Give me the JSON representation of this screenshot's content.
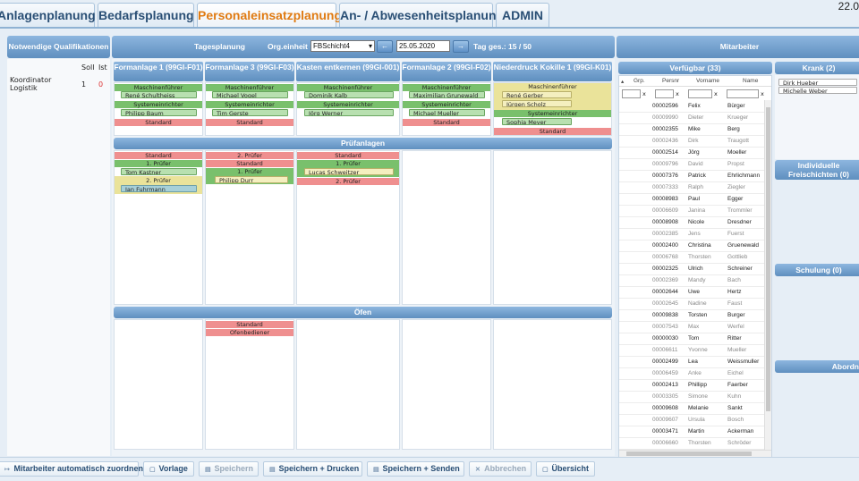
{
  "tabs": [
    "Anlagenplanung",
    "Bedarfsplanung",
    "Personaleinsatzplanung",
    "An- / Abwesenheitsplanung",
    "ADMIN"
  ],
  "corner_text": "22.0",
  "left": {
    "title": "Notwendige Qualifikationen",
    "soll": "Soll",
    "ist": "Ist",
    "role": "Koordinator Logistik",
    "soll_val": "1",
    "ist_val": "0"
  },
  "tagesplanung": {
    "title": "Tagesplanung",
    "org_label": "Org.einheit",
    "org_value": "FBSchicht4",
    "date": "25.05.2020",
    "prev": "←",
    "next": "→",
    "summary": "Tag ges.: 15 / 50"
  },
  "columns": [
    {
      "title": "Formanlage 1 (99GI-F01)",
      "items": [
        {
          "bar": "Maschinenführer",
          "color": "g",
          "chips": [
            "René Schultheiss"
          ]
        },
        {
          "bar": "Systemeinrichter",
          "color": "g",
          "chips": [
            "Philipp Baum"
          ]
        },
        {
          "bar": "Standard",
          "color": "r",
          "chips": []
        }
      ]
    },
    {
      "title": "Formanlage 3 (99GI-F03)",
      "items": [
        {
          "bar": "Maschinenführer",
          "color": "g",
          "chips": [
            "Michael Vogel"
          ]
        },
        {
          "bar": "Systemeinrichter",
          "color": "g",
          "chips": [
            "Tim Gerste"
          ]
        },
        {
          "bar": "Standard",
          "color": "r",
          "chips": []
        }
      ]
    },
    {
      "title": "Kasten entkernen (99GI-001)",
      "items": [
        {
          "bar": "Maschinenführer",
          "color": "g",
          "chips": [
            "Dominik Kalb"
          ]
        },
        {
          "bar": "Systemeinrichter",
          "color": "g",
          "chips": [
            "Jörg Werner"
          ]
        }
      ]
    },
    {
      "title": "Formanlage 2 (99GI-F02)",
      "items": [
        {
          "bar": "Maschinenführer",
          "color": "g",
          "chips": [
            "Maximilian Grunewald"
          ]
        },
        {
          "bar": "Systemeinrichter",
          "color": "g",
          "chips": [
            "Michael Mueller"
          ]
        },
        {
          "bar": "Standard",
          "color": "r",
          "chips": []
        }
      ]
    },
    {
      "title": "Niederdruck Kokille 1 (99GI-K01)",
      "items": [
        {
          "bar": "Maschinenführer",
          "color": "y",
          "chips": [
            "René Gerber",
            "Jürgen Scholz"
          ]
        },
        {
          "bar": "Systemeinrichter",
          "color": "g",
          "chips": [
            "Sophia Meyer"
          ]
        },
        {
          "bar": "Standard",
          "color": "r",
          "chips": []
        }
      ]
    }
  ],
  "pruefanlagen": {
    "title": "Prüfanlagen",
    "cols": [
      [
        {
          "bar": "Standard",
          "color": "r",
          "chips": []
        },
        {
          "bar": "1. Prüfer",
          "color": "g",
          "chips": [
            "Tom Kastner"
          ]
        },
        {
          "bar": "2. Prüfer",
          "color": "y",
          "chips": [
            "Jan Fuhrmann"
          ]
        }
      ],
      [
        {
          "bar": "2. Prüfer",
          "color": "r",
          "chips": []
        },
        {
          "bar": "Standard",
          "color": "r",
          "chips": []
        },
        {
          "bar": "1. Prüfer",
          "color": "g",
          "chips": [
            "Philipp Durr"
          ]
        }
      ],
      [
        {
          "bar": "Standard",
          "color": "r",
          "chips": []
        },
        {
          "bar": "1. Prüfer",
          "color": "g",
          "chips": [
            "Lucas Schweitzer"
          ]
        },
        {
          "bar": "2. Prüfer",
          "color": "r",
          "chips": []
        }
      ]
    ]
  },
  "oefen": {
    "title": "Öfen",
    "cols": [
      [],
      [
        {
          "bar": "Standard",
          "color": "r",
          "chips": []
        },
        {
          "bar": "Ofenbediener",
          "color": "r",
          "chips": []
        }
      ]
    ]
  },
  "mitarbeiter": {
    "title": "Mitarbeiter",
    "verfuegbar": "Verfügbar (33)",
    "krank": "Krank (2)",
    "indiv": "Individuelle Freischichten (0)",
    "schulung": "Schulung (0)",
    "abord": "Abordn",
    "krank_list": [
      "Dirk Hueber",
      "Michelle Weber"
    ],
    "headers": [
      "Grp.",
      "Persnr",
      "Vorname",
      "Name"
    ],
    "rows": [
      [
        "00002596",
        "Felix",
        "Bürger",
        0
      ],
      [
        "00009990",
        "Dieter",
        "Krueger",
        1
      ],
      [
        "00002355",
        "Mike",
        "Berg",
        0
      ],
      [
        "00002436",
        "Dirk",
        "Traugott",
        1
      ],
      [
        "00002514",
        "Jörg",
        "Moeller",
        0
      ],
      [
        "00009796",
        "David",
        "Propst",
        1
      ],
      [
        "00007376",
        "Patrick",
        "Ehrlichmann",
        0
      ],
      [
        "00007333",
        "Ralph",
        "Ziegler",
        1
      ],
      [
        "00008983",
        "Paul",
        "Egger",
        0
      ],
      [
        "00006609",
        "Janina",
        "Trommler",
        1
      ],
      [
        "00008908",
        "Nicole",
        "Dresdner",
        0
      ],
      [
        "00002385",
        "Jens",
        "Fuerst",
        1
      ],
      [
        "00002400",
        "Christina",
        "Gruenewald",
        0
      ],
      [
        "00006768",
        "Thorsten",
        "Gottlieb",
        1
      ],
      [
        "00002325",
        "Ulrich",
        "Schreiner",
        0
      ],
      [
        "00002369",
        "Mandy",
        "Bach",
        1
      ],
      [
        "00002644",
        "Uwe",
        "Hertz",
        0
      ],
      [
        "00002645",
        "Nadine",
        "Faust",
        1
      ],
      [
        "00009838",
        "Torsten",
        "Burger",
        0
      ],
      [
        "00007543",
        "Max",
        "Werfel",
        1
      ],
      [
        "00000030",
        "Tom",
        "Ritter",
        0
      ],
      [
        "00006611",
        "Yvonne",
        "Mueller",
        1
      ],
      [
        "00002499",
        "Lea",
        "Weissmuller",
        0
      ],
      [
        "00006459",
        "Anke",
        "Eichel",
        1
      ],
      [
        "00002413",
        "Phillipp",
        "Faerber",
        0
      ],
      [
        "00003305",
        "Simone",
        "Kuhn",
        1
      ],
      [
        "00009608",
        "Melanie",
        "Sankt",
        0
      ],
      [
        "00009607",
        "Ursula",
        "Bosch",
        1
      ],
      [
        "00003471",
        "Martin",
        "Ackerman",
        0
      ],
      [
        "00006660",
        "Thorsten",
        "Schröder",
        1
      ]
    ]
  },
  "bottom": [
    "Mitarbeiter automatisch zuordnen",
    "Vorlage",
    "Speichern",
    "Speichern + Drucken",
    "Speichern + Senden",
    "Abbrechen",
    "Übersicht"
  ]
}
